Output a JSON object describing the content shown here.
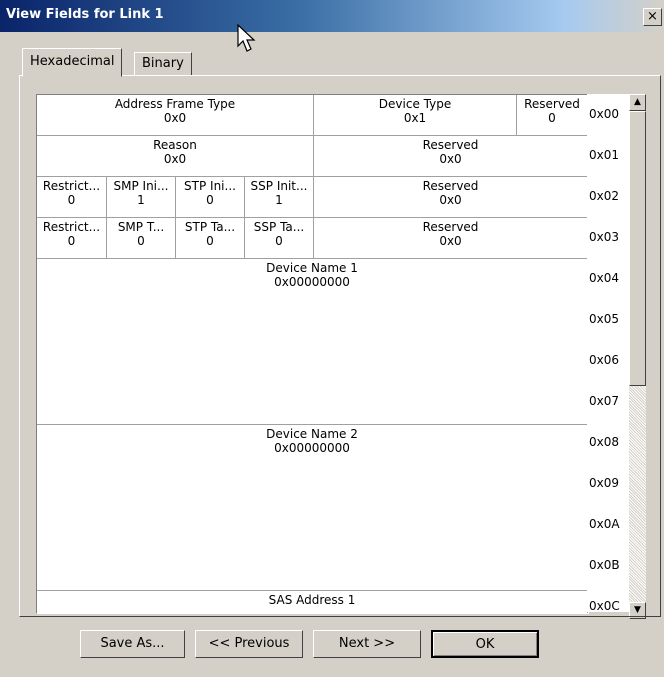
{
  "window": {
    "title": "View Fields for Link 1",
    "close_glyph": "×"
  },
  "tabs": [
    {
      "label": "Hexadecimal"
    },
    {
      "label": "Binary"
    }
  ],
  "fields": {
    "address_frame_type": {
      "name": "Address Frame Type",
      "value": "0x0"
    },
    "device_type": {
      "name": "Device Type",
      "value": "0x1"
    },
    "reserved_a": {
      "name": "Reserved",
      "value": "0"
    },
    "reason": {
      "name": "Reason",
      "value": "0x0"
    },
    "reserved_b": {
      "name": "Reserved",
      "value": "0x0"
    },
    "row2": [
      {
        "name": "Restrict...",
        "value": "0"
      },
      {
        "name": "SMP Ini...",
        "value": "1"
      },
      {
        "name": "STP Ini...",
        "value": "0"
      },
      {
        "name": "SSP Init...",
        "value": "1"
      }
    ],
    "reserved_c": {
      "name": "Reserved",
      "value": "0x0"
    },
    "row3": [
      {
        "name": "Restrict...",
        "value": "0"
      },
      {
        "name": "SMP T...",
        "value": "0"
      },
      {
        "name": "STP Ta...",
        "value": "0"
      },
      {
        "name": "SSP Ta...",
        "value": "0"
      }
    ],
    "reserved_d": {
      "name": "Reserved",
      "value": "0x0"
    },
    "device_name_1": {
      "name": "Device Name 1",
      "value": "0x00000000"
    },
    "device_name_2": {
      "name": "Device Name 2",
      "value": "0x00000000"
    },
    "sas_address_1": {
      "name": "SAS Address 1"
    }
  },
  "offsets": [
    "0x00",
    "0x01",
    "0x02",
    "0x03",
    "0x04",
    "0x05",
    "0x06",
    "0x07",
    "0x08",
    "0x09",
    "0x0A",
    "0x0B",
    "0x0C"
  ],
  "scrollbar": {
    "up": "▲",
    "down": "▼"
  },
  "buttons": {
    "save_as": "Save As...",
    "previous": "<< Previous",
    "next": "Next >>",
    "ok": "OK"
  }
}
